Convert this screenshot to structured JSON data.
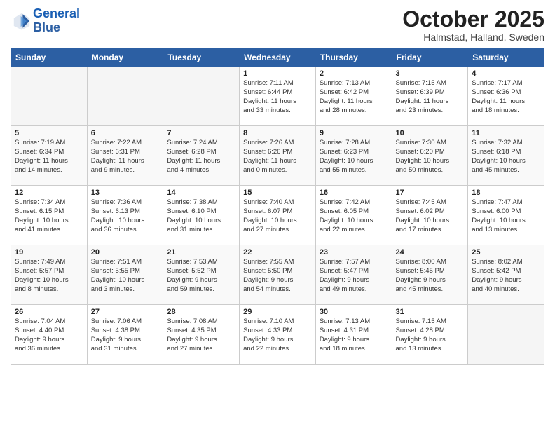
{
  "header": {
    "logo_general": "General",
    "logo_blue": "Blue",
    "month": "October 2025",
    "location": "Halmstad, Halland, Sweden"
  },
  "days_of_week": [
    "Sunday",
    "Monday",
    "Tuesday",
    "Wednesday",
    "Thursday",
    "Friday",
    "Saturday"
  ],
  "weeks": [
    [
      {
        "num": "",
        "info": ""
      },
      {
        "num": "",
        "info": ""
      },
      {
        "num": "",
        "info": ""
      },
      {
        "num": "1",
        "info": "Sunrise: 7:11 AM\nSunset: 6:44 PM\nDaylight: 11 hours\nand 33 minutes."
      },
      {
        "num": "2",
        "info": "Sunrise: 7:13 AM\nSunset: 6:42 PM\nDaylight: 11 hours\nand 28 minutes."
      },
      {
        "num": "3",
        "info": "Sunrise: 7:15 AM\nSunset: 6:39 PM\nDaylight: 11 hours\nand 23 minutes."
      },
      {
        "num": "4",
        "info": "Sunrise: 7:17 AM\nSunset: 6:36 PM\nDaylight: 11 hours\nand 18 minutes."
      }
    ],
    [
      {
        "num": "5",
        "info": "Sunrise: 7:19 AM\nSunset: 6:34 PM\nDaylight: 11 hours\nand 14 minutes."
      },
      {
        "num": "6",
        "info": "Sunrise: 7:22 AM\nSunset: 6:31 PM\nDaylight: 11 hours\nand 9 minutes."
      },
      {
        "num": "7",
        "info": "Sunrise: 7:24 AM\nSunset: 6:28 PM\nDaylight: 11 hours\nand 4 minutes."
      },
      {
        "num": "8",
        "info": "Sunrise: 7:26 AM\nSunset: 6:26 PM\nDaylight: 11 hours\nand 0 minutes."
      },
      {
        "num": "9",
        "info": "Sunrise: 7:28 AM\nSunset: 6:23 PM\nDaylight: 10 hours\nand 55 minutes."
      },
      {
        "num": "10",
        "info": "Sunrise: 7:30 AM\nSunset: 6:20 PM\nDaylight: 10 hours\nand 50 minutes."
      },
      {
        "num": "11",
        "info": "Sunrise: 7:32 AM\nSunset: 6:18 PM\nDaylight: 10 hours\nand 45 minutes."
      }
    ],
    [
      {
        "num": "12",
        "info": "Sunrise: 7:34 AM\nSunset: 6:15 PM\nDaylight: 10 hours\nand 41 minutes."
      },
      {
        "num": "13",
        "info": "Sunrise: 7:36 AM\nSunset: 6:13 PM\nDaylight: 10 hours\nand 36 minutes."
      },
      {
        "num": "14",
        "info": "Sunrise: 7:38 AM\nSunset: 6:10 PM\nDaylight: 10 hours\nand 31 minutes."
      },
      {
        "num": "15",
        "info": "Sunrise: 7:40 AM\nSunset: 6:07 PM\nDaylight: 10 hours\nand 27 minutes."
      },
      {
        "num": "16",
        "info": "Sunrise: 7:42 AM\nSunset: 6:05 PM\nDaylight: 10 hours\nand 22 minutes."
      },
      {
        "num": "17",
        "info": "Sunrise: 7:45 AM\nSunset: 6:02 PM\nDaylight: 10 hours\nand 17 minutes."
      },
      {
        "num": "18",
        "info": "Sunrise: 7:47 AM\nSunset: 6:00 PM\nDaylight: 10 hours\nand 13 minutes."
      }
    ],
    [
      {
        "num": "19",
        "info": "Sunrise: 7:49 AM\nSunset: 5:57 PM\nDaylight: 10 hours\nand 8 minutes."
      },
      {
        "num": "20",
        "info": "Sunrise: 7:51 AM\nSunset: 5:55 PM\nDaylight: 10 hours\nand 3 minutes."
      },
      {
        "num": "21",
        "info": "Sunrise: 7:53 AM\nSunset: 5:52 PM\nDaylight: 9 hours\nand 59 minutes."
      },
      {
        "num": "22",
        "info": "Sunrise: 7:55 AM\nSunset: 5:50 PM\nDaylight: 9 hours\nand 54 minutes."
      },
      {
        "num": "23",
        "info": "Sunrise: 7:57 AM\nSunset: 5:47 PM\nDaylight: 9 hours\nand 49 minutes."
      },
      {
        "num": "24",
        "info": "Sunrise: 8:00 AM\nSunset: 5:45 PM\nDaylight: 9 hours\nand 45 minutes."
      },
      {
        "num": "25",
        "info": "Sunrise: 8:02 AM\nSunset: 5:42 PM\nDaylight: 9 hours\nand 40 minutes."
      }
    ],
    [
      {
        "num": "26",
        "info": "Sunrise: 7:04 AM\nSunset: 4:40 PM\nDaylight: 9 hours\nand 36 minutes."
      },
      {
        "num": "27",
        "info": "Sunrise: 7:06 AM\nSunset: 4:38 PM\nDaylight: 9 hours\nand 31 minutes."
      },
      {
        "num": "28",
        "info": "Sunrise: 7:08 AM\nSunset: 4:35 PM\nDaylight: 9 hours\nand 27 minutes."
      },
      {
        "num": "29",
        "info": "Sunrise: 7:10 AM\nSunset: 4:33 PM\nDaylight: 9 hours\nand 22 minutes."
      },
      {
        "num": "30",
        "info": "Sunrise: 7:13 AM\nSunset: 4:31 PM\nDaylight: 9 hours\nand 18 minutes."
      },
      {
        "num": "31",
        "info": "Sunrise: 7:15 AM\nSunset: 4:28 PM\nDaylight: 9 hours\nand 13 minutes."
      },
      {
        "num": "",
        "info": ""
      }
    ]
  ]
}
